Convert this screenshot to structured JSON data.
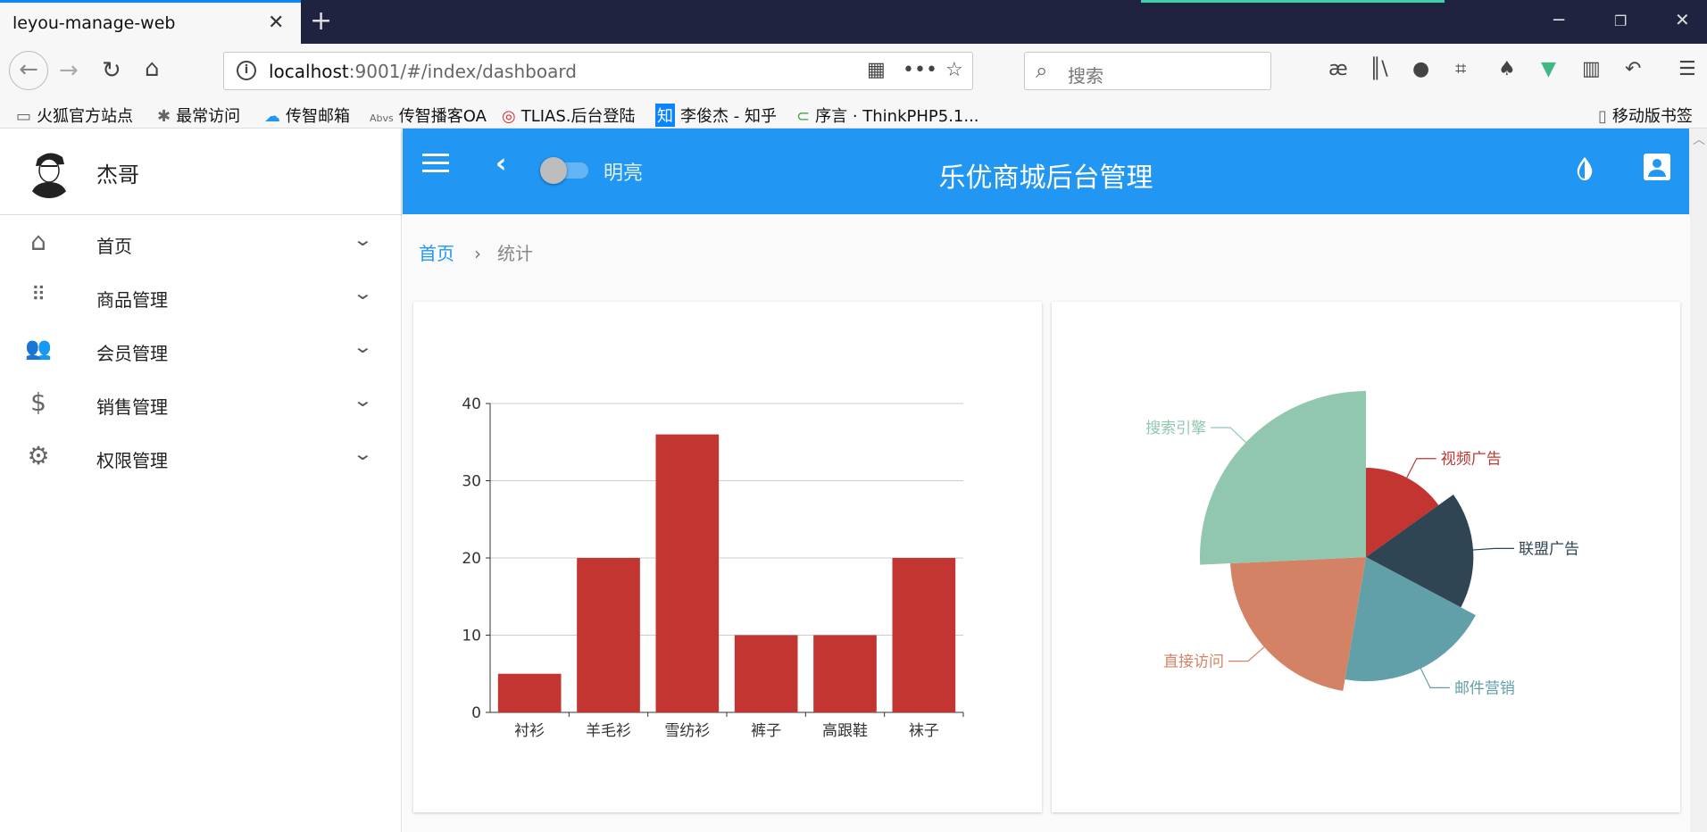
{
  "browser": {
    "tab_title": "leyou-manage-web",
    "url_host": "localhost",
    "url_rest": ":9001/#/index/dashboard",
    "search_placeholder": "搜索",
    "bookmarks": [
      {
        "icon": "folder-icon",
        "label": "火狐官方站点"
      },
      {
        "icon": "gear-icon",
        "label": "最常访问"
      },
      {
        "icon": "mail-icon",
        "label": "传智邮箱"
      },
      {
        "icon": "oa-icon",
        "label": "传智播客OA"
      },
      {
        "icon": "tlias-icon",
        "label": "TLIAS.后台登陆"
      },
      {
        "icon": "zhihu-icon",
        "label": "李俊杰 - 知乎"
      },
      {
        "icon": "thinkphp-icon",
        "label": "序言 · ThinkPHP5.1..."
      }
    ],
    "mobile_bookmarks": "移动版书签"
  },
  "sidebar": {
    "username": "杰哥",
    "items": [
      {
        "icon": "home-icon",
        "label": "首页"
      },
      {
        "icon": "grid-icon",
        "label": "商品管理"
      },
      {
        "icon": "people-icon",
        "label": "会员管理"
      },
      {
        "icon": "dollar-icon",
        "label": "销售管理"
      },
      {
        "icon": "settings-icon",
        "label": "权限管理"
      }
    ]
  },
  "appbar": {
    "switch_label": "明亮",
    "title": "乐优商城后台管理"
  },
  "breadcrumb": {
    "home": "首页",
    "current": "统计"
  },
  "colors": {
    "primary": "#2196f3",
    "bar": "#c23531"
  },
  "chart_data": [
    {
      "type": "bar",
      "categories": [
        "衬衫",
        "羊毛衫",
        "雪纺衫",
        "裤子",
        "高跟鞋",
        "袜子"
      ],
      "values": [
        5,
        20,
        36,
        10,
        10,
        20
      ],
      "ylim": [
        0,
        40
      ],
      "yticks": [
        0,
        10,
        20,
        30,
        40
      ],
      "grid": true
    },
    {
      "type": "pie",
      "rose": true,
      "slices": [
        {
          "name": "视频广告",
          "value": 235,
          "color": "#c23531"
        },
        {
          "name": "联盟广告",
          "value": 274,
          "color": "#2f4554"
        },
        {
          "name": "邮件营销",
          "value": 310,
          "color": "#61a0a8"
        },
        {
          "name": "直接访问",
          "value": 335,
          "color": "#d48265"
        },
        {
          "name": "搜索引擎",
          "value": 400,
          "color": "#91c7ae"
        }
      ]
    }
  ]
}
